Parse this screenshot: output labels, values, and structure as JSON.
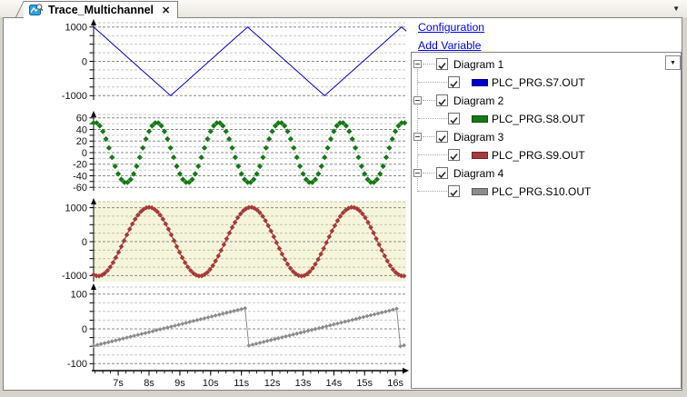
{
  "window": {
    "tab": {
      "title": "Trace_Multichannel",
      "close_glyph": "✕"
    },
    "tab_overflow_glyph": "▼"
  },
  "panel": {
    "links": [
      {
        "label": "Configuration"
      },
      {
        "label": "Add Variable"
      }
    ],
    "dropdown_glyph": "▼"
  },
  "tree": {
    "groups": [
      {
        "label": "Diagram 1",
        "checked": true,
        "child": {
          "label": "PLC_PRG.S7.OUT",
          "checked": true,
          "color": "#0000C8"
        }
      },
      {
        "label": "Diagram 2",
        "checked": true,
        "child": {
          "label": "PLC_PRG.S8.OUT",
          "checked": true,
          "color": "#157815"
        }
      },
      {
        "label": "Diagram 3",
        "checked": true,
        "child": {
          "label": "PLC_PRG.S9.OUT",
          "checked": true,
          "color": "#A63A3A"
        }
      },
      {
        "label": "Diagram 4",
        "checked": true,
        "child": {
          "label": "PLC_PRG.S10.OUT",
          "checked": true,
          "color": "#8C8C8C"
        }
      }
    ]
  },
  "chart_data": [
    {
      "type": "line",
      "title": "Diagram 1",
      "bg": "#FFFFFF",
      "grid": true,
      "xlim": [
        6.2,
        16.35
      ],
      "ylim": [
        -1125,
        1125
      ],
      "yticks": [
        1000,
        0,
        -1000
      ],
      "ytick_step": 250,
      "series": [
        {
          "name": "PLC_PRG.S7.OUT",
          "color": "#0000C8",
          "waveform": "triangle",
          "amplitude": 1000,
          "period_s": 5,
          "peak_at_s": 6.2,
          "sample_interval_s": 0.05,
          "line": true,
          "markers": false,
          "stroke_w": 1,
          "keypoints": [
            [
              6.2,
              1000
            ],
            [
              8.7,
              -1000
            ],
            [
              11.2,
              1000
            ],
            [
              13.7,
              -1000
            ],
            [
              16.2,
              1000
            ]
          ]
        }
      ]
    },
    {
      "type": "scatter",
      "title": "Diagram 2",
      "bg": "#FFFFFF",
      "grid": true,
      "xlim": [
        6.2,
        16.35
      ],
      "ylim": [
        -66,
        66
      ],
      "yticks": [
        60,
        40,
        20,
        0,
        -20,
        -40,
        -60
      ],
      "ytick_step": 10,
      "series": [
        {
          "name": "PLC_PRG.S8.OUT",
          "color": "#157815",
          "waveform": "sine",
          "amplitude": 52,
          "period_s": 2,
          "peak_at_s": 6.25,
          "sample_interval_s": 0.1,
          "line": false,
          "markers": true,
          "marker_r": 3.1,
          "keypoints": [
            [
              6.25,
              52
            ],
            [
              7.25,
              -52
            ],
            [
              8.25,
              52
            ],
            [
              10.25,
              52
            ],
            [
              12.25,
              52
            ],
            [
              14.25,
              52
            ],
            [
              16.25,
              52
            ]
          ]
        }
      ]
    },
    {
      "type": "line",
      "title": "Diagram 3",
      "bg": "#F5F5DC",
      "grid": true,
      "minor_grid": "#C4C4AE",
      "xlim": [
        6.2,
        16.35
      ],
      "ylim": [
        -1175,
        1175
      ],
      "yticks": [
        1000,
        0,
        -1000
      ],
      "ytick_step": 250,
      "series": [
        {
          "name": "PLC_PRG.S9.OUT",
          "color": "#A63A3A",
          "waveform": "sine",
          "amplitude": 1010,
          "period_s": 3.3,
          "peak_at_s": 8.0,
          "sample_interval_s": 0.09,
          "line": true,
          "markers": true,
          "marker_r": 2.8,
          "stroke_w": 1.2,
          "keypoints": [
            [
              6.35,
              -1010
            ],
            [
              8.0,
              1010
            ],
            [
              9.65,
              -1010
            ],
            [
              11.3,
              1010
            ],
            [
              12.95,
              -1010
            ],
            [
              14.6,
              1010
            ],
            [
              16.25,
              -1010
            ]
          ]
        }
      ]
    },
    {
      "type": "line",
      "title": "Diagram 4",
      "bg": "#FFFFFF",
      "grid": true,
      "xlim": [
        6.2,
        16.35
      ],
      "ylim": [
        -120,
        120
      ],
      "yticks": [
        100,
        0,
        -100
      ],
      "ytick_step": 25,
      "xticks": [
        "7s",
        "8s",
        "9s",
        "10s",
        "11s",
        "12s",
        "13s",
        "14s",
        "15s",
        "16s"
      ],
      "xtick_start": 7,
      "x_minor_step": 0.25,
      "series": [
        {
          "name": "PLC_PRG.S10.OUT",
          "color": "#8C8C8C",
          "waveform": "sawtooth",
          "min": -50,
          "max": 60,
          "period_s": 5,
          "reset_at_s": 11.15,
          "sample_interval_s": 0.12,
          "line": true,
          "markers": true,
          "marker_r": 2.4,
          "stroke_w": 1,
          "keypoints": [
            [
              6.2,
              -49
            ],
            [
              11.14,
              60
            ],
            [
              11.16,
              -50
            ],
            [
              16.14,
              60
            ],
            [
              16.16,
              -50
            ]
          ]
        }
      ]
    }
  ]
}
